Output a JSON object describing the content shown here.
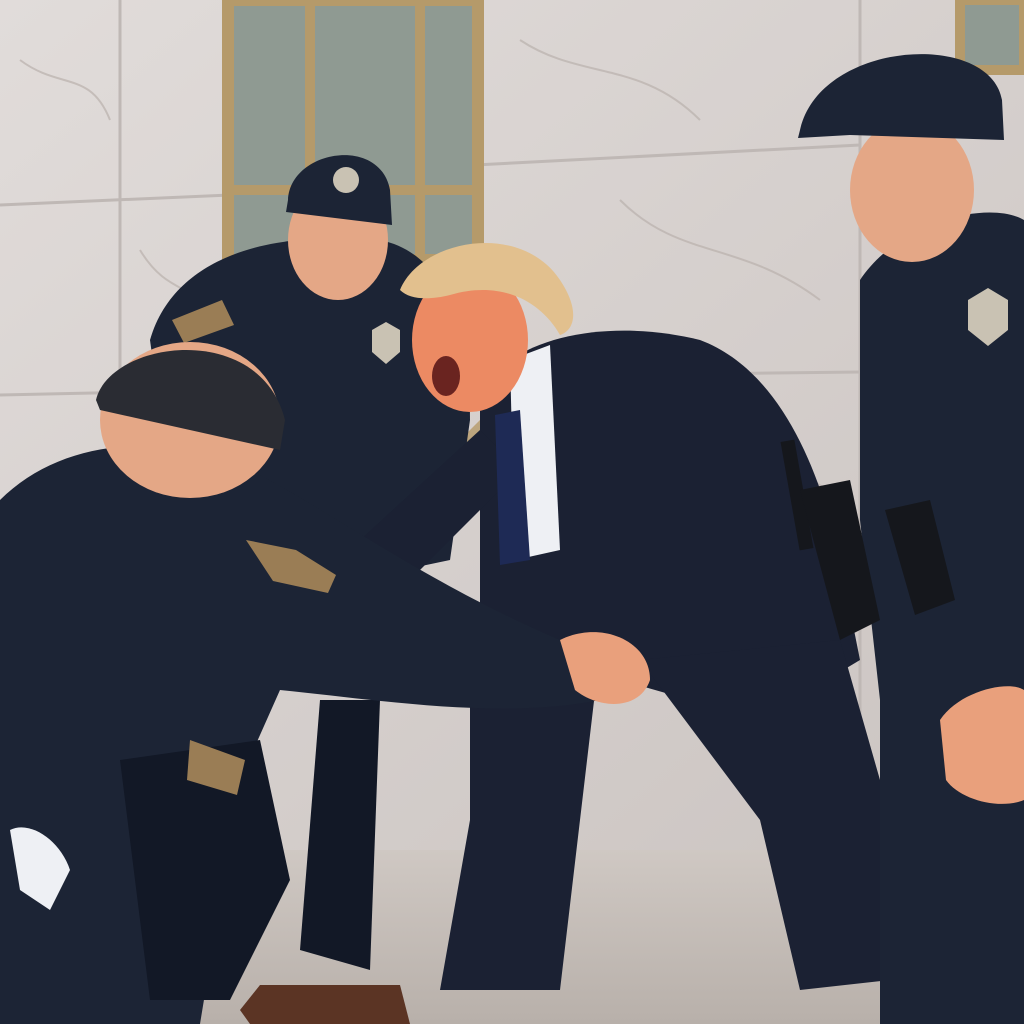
{
  "colors": {
    "marble": "#d9d3d1",
    "marble_vein": "#bdb5b2",
    "window_frame": "#b59a6a",
    "window_glass": "#8f9a92",
    "pavement": "#c6bfba",
    "uniform": "#1c2435",
    "uniform_shadow": "#121826",
    "suit": "#1b2133",
    "shirt": "#eef0f4",
    "tie": "#1e2a55",
    "hair": "#e2c08e",
    "skin": "#e9a07c",
    "skin_flushed": "#ec8a63",
    "badge": "#c9c2b3",
    "patch": "#9a7d55",
    "holster": "#15171c"
  }
}
